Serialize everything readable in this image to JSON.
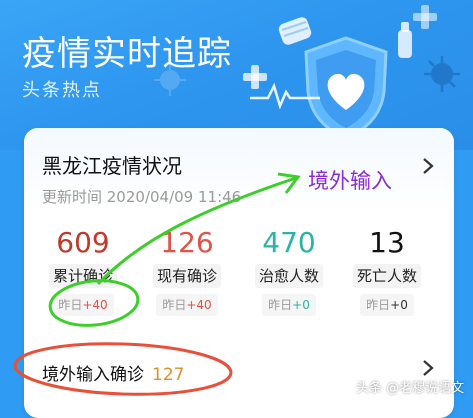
{
  "header": {
    "title": "疫情实时追踪",
    "subtitle": "头条热点"
  },
  "card": {
    "region_title": "黑龙江疫情状况",
    "update_time": "更新时间 2020/04/09 11:46",
    "import_link": "境外输入",
    "stats": [
      {
        "value": "609",
        "label": "累计确诊",
        "delta_prefix": "昨日",
        "delta": "+40",
        "color": "#c0392b"
      },
      {
        "value": "126",
        "label": "现有确诊",
        "delta_prefix": "昨日",
        "delta": "+40",
        "color": "#e0524a"
      },
      {
        "value": "470",
        "label": "治愈人数",
        "delta_prefix": "昨日",
        "delta": "+0",
        "color": "#2bb3a6"
      },
      {
        "value": "13",
        "label": "死亡人数",
        "delta_prefix": "昨日",
        "delta": "+0",
        "color": "#111111"
      }
    ],
    "import_row": {
      "label": "境外输入确诊",
      "count": "127"
    }
  },
  "watermark": "头条 @老穆说语文",
  "colors": {
    "hero_blue": "#2e96ef",
    "link_purple": "#8b2bd6",
    "count_orange": "#d7922c",
    "annotation_green": "#3ccf2a",
    "annotation_red": "#e8503a"
  },
  "icons": [
    "shield-heart-icon",
    "mask-icon",
    "virus-icon",
    "chevron-right-icon"
  ]
}
